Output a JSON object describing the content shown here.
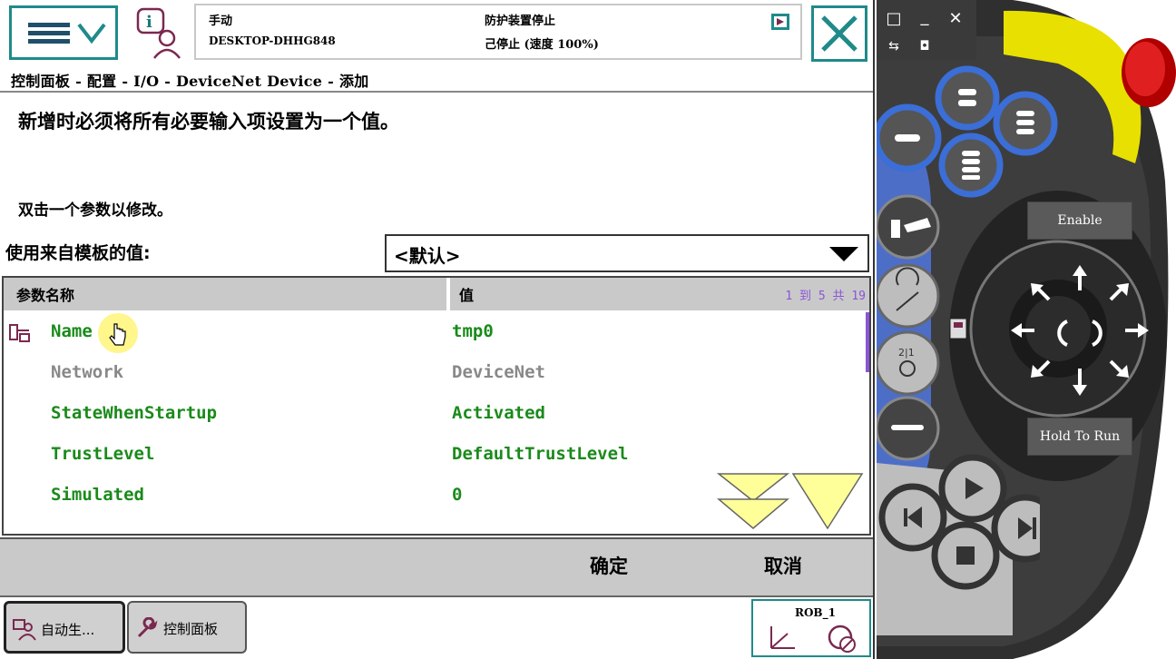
{
  "header": {
    "mode": "手动",
    "system_name": "DESKTOP-DHHG848",
    "safety_state": "防护装置停止",
    "run_state": "己停止 (速度 100%)"
  },
  "breadcrumb": "控制面板 - 配置 - I/O - DeviceNet Device - 添加",
  "info": {
    "line1": "新增时必须将所有必要输入项设置为一个值。",
    "line2": "双击一个参数以修改。"
  },
  "template": {
    "label": "使用来自模板的值:",
    "value": "<默认>"
  },
  "table": {
    "col_name": "参数名称",
    "col_value": "值",
    "count": "1 到 5 共 19",
    "rows": [
      {
        "name": "Name",
        "value": "tmp0"
      },
      {
        "name": "Network",
        "value": "DeviceNet"
      },
      {
        "name": "StateWhenStartup",
        "value": "Activated"
      },
      {
        "name": "TrustLevel",
        "value": "DefaultTrustLevel"
      },
      {
        "name": "Simulated",
        "value": "0"
      }
    ]
  },
  "actions": {
    "ok": "确定",
    "cancel": "取消"
  },
  "taskbar": {
    "task1": "自动生...",
    "task2": "控制面板",
    "robot": "ROB_1"
  },
  "device": {
    "enable_label": "Enable",
    "hold_label": "Hold To Run"
  },
  "colors": {
    "accent": "#1f8a8a",
    "editable_text": "#1a8a1a",
    "readonly_text": "#888888",
    "counter": "#8a55d6"
  }
}
